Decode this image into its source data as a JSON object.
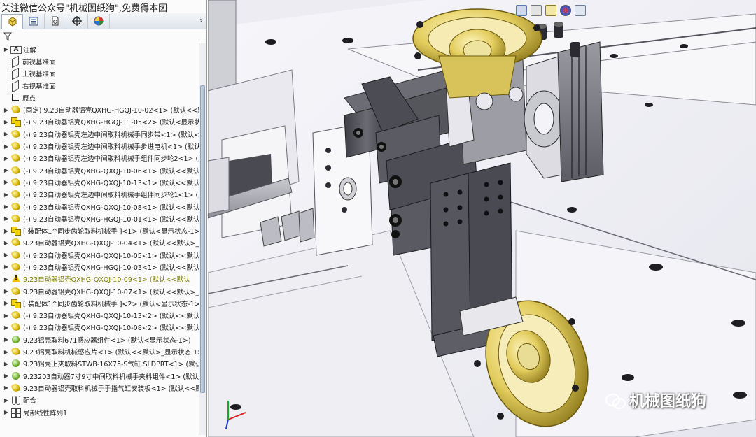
{
  "watermark_top": "关注微信公众号\"机械图纸狗\",免费得本图",
  "brand_watermark": "机械图纸狗",
  "tabs": [
    {
      "icon": "feature-manager-icon",
      "active": true
    },
    {
      "icon": "property-manager-icon",
      "active": false
    },
    {
      "icon": "configuration-manager-icon",
      "active": false
    },
    {
      "icon": "dimxpert-icon",
      "active": false
    },
    {
      "icon": "display-manager-icon",
      "active": false
    }
  ],
  "tree": {
    "top_items": [
      {
        "icon": "annotation-icon",
        "label": "注解",
        "expandable": true
      },
      {
        "icon": "plane-icon",
        "label": "前视基准面",
        "expandable": false
      },
      {
        "icon": "plane-icon",
        "label": "上视基准面",
        "expandable": false
      },
      {
        "icon": "plane-icon",
        "label": "右视基准面",
        "expandable": false
      },
      {
        "icon": "origin-icon",
        "label": "原点",
        "expandable": false
      }
    ],
    "components": [
      {
        "icon": "part-icon",
        "label": "(固定) 9.23自动器铝壳QXHG-HGQJ-10-02<1> (默认<<默"
      },
      {
        "icon": "assembly-icon",
        "label": "(-) 9.23自动器铝壳QXHG-HGQJ-11-05<2> (默认<显示状"
      },
      {
        "icon": "part-icon",
        "label": "(-) 9.23自动器铝壳左边中间取料机械手同步带<1> (默认<<默"
      },
      {
        "icon": "part-icon",
        "label": "(-) 9.23自动器铝壳左边中间取料机械手步进电机<1> (默认"
      },
      {
        "icon": "part-icon",
        "label": "(-) 9.23自动器铝壳左边中间取料机械手组件同步轮2<1> (默"
      },
      {
        "icon": "part-icon",
        "label": "(-) 9.23自动器铝壳QXHG-QXQJ-10-06<1> (默认<<默认>"
      },
      {
        "icon": "part-icon",
        "label": "(-) 9.23自动器铝壳QXHG-QXQJ-10-13<1> (默认<<默认>"
      },
      {
        "icon": "part-icon",
        "label": "(-) 9.23自动器铝壳左边中间取料机械手组件同步轮1<1> (默"
      },
      {
        "icon": "part-icon",
        "label": "(-) 9.23自动器铝壳QXHG-QXQJ-10-08<1> (默认<<默认>"
      },
      {
        "icon": "part-icon",
        "label": "(-) 9.23自动器铝壳QXHG-HGQJ-10-01<1> (默认<<默认>_"
      },
      {
        "icon": "assembly-icon",
        "label": "[ 装配体1^同步齿轮取料机械手 ]<1> (默认<显示状态-1>"
      },
      {
        "icon": "part-icon",
        "label": "9.23自动器铝壳QXHG-QXQJ-10-04<1> (默认<<默认>_"
      },
      {
        "icon": "part-icon",
        "label": "(-) 9.23自动器铝壳QXHG-QXQJ-10-05<1> (默认<<默认>"
      },
      {
        "icon": "part-icon",
        "label": "(-) 9.23自动器铝壳QXHG-HGQJ-10-03<1> (默认<<默认>"
      },
      {
        "icon": "warning-icon",
        "label": "9.23自动器铝壳QXHG-QXQJ-10-09<1> (默认<<默认",
        "warning": true
      },
      {
        "icon": "part-icon",
        "label": "9.23自动器铝壳QXHG-QXQJ-10-07<1> (默认<<默认>_"
      },
      {
        "icon": "assembly-icon",
        "label": "[ 装配体1^同步齿轮取料机械手 ]<2> (默认<显示状态-1>"
      },
      {
        "icon": "part-icon",
        "label": "(-) 9.23自动器铝壳QXHG-QXQJ-10-13<2> (默认<<默认>"
      },
      {
        "icon": "part-icon",
        "label": "(-) 9.23自动器铝壳QXHG-QXQJ-10-08<2> (默认<<默认>"
      },
      {
        "icon": "green-assembly-icon",
        "label": "9.23铝壳取料671感应器组件<1> (默认<显示状态-1>)"
      },
      {
        "icon": "part-icon",
        "label": "9.23铝壳取料机械感应片<1> (默认<<默认>_显示状态 1>"
      },
      {
        "icon": "green-assembly-icon",
        "label": "9.23铝壳上夹取料STWB-16X75-S气缸.SLDPRT<1> (默认<"
      },
      {
        "icon": "green-assembly-icon",
        "label": "9.23203自动器7寸9寸中间取料机械手夹料组件<1> (默认"
      },
      {
        "icon": "part-icon",
        "label": "9.23自动器铝壳取料机械手手指气缸安装板<1> (默认<<默"
      },
      {
        "icon": "mates-icon",
        "label": "配合"
      },
      {
        "icon": "pattern-icon",
        "label": "局部线性阵列1"
      }
    ]
  },
  "colors": {
    "brass": "#e6d36a",
    "brass_dark": "#8f7a1c",
    "steel_dark": "#4b4b52",
    "steel_mid": "#8a8a92",
    "plate": "#f2f2f7",
    "tree_bg": "#fbfbfb"
  }
}
